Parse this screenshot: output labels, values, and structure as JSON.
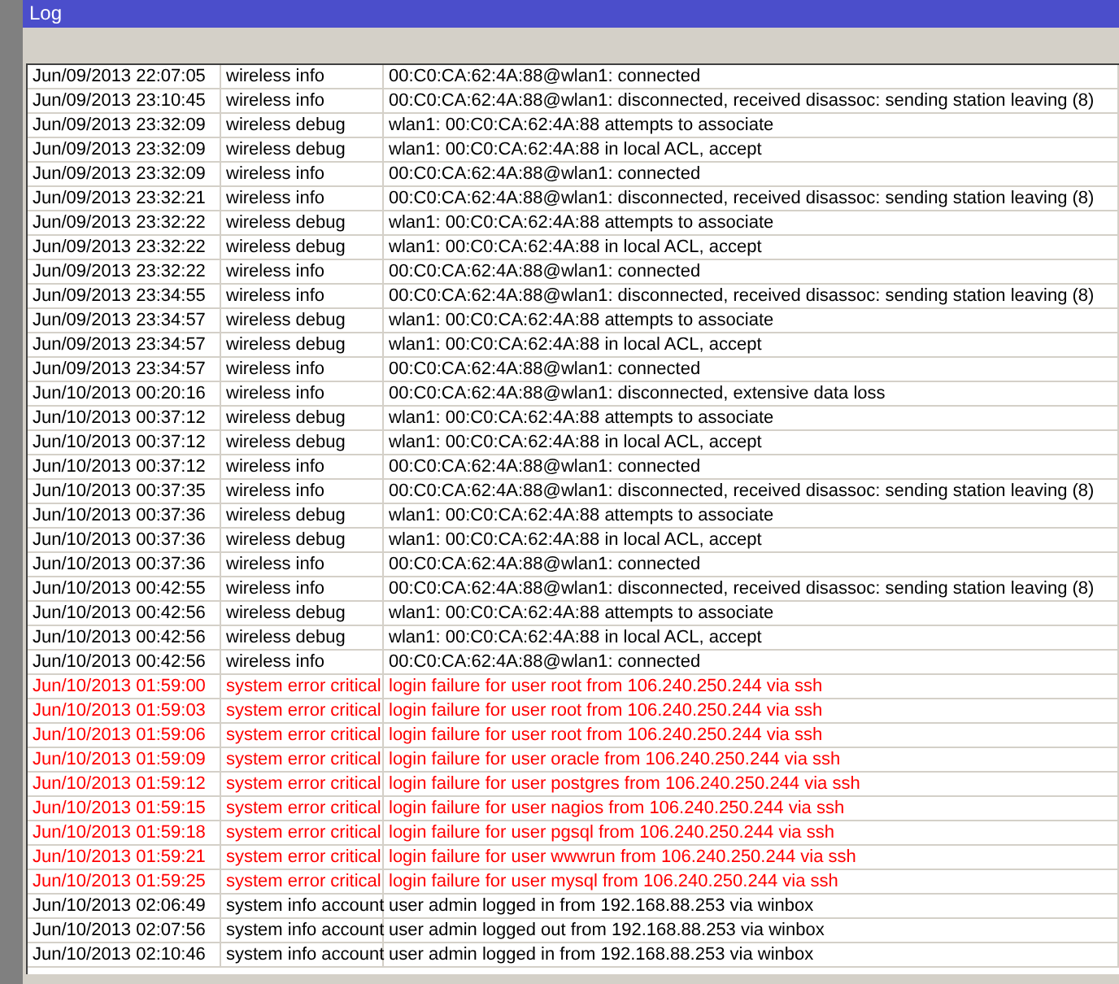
{
  "window": {
    "title": "Log"
  },
  "rows": [
    {
      "time": "Jun/09/2013 22:07:05",
      "topics": "wireless info",
      "message": "00:C0:CA:62:4A:88@wlan1: connected",
      "critical": false
    },
    {
      "time": "Jun/09/2013 23:10:45",
      "topics": "wireless info",
      "message": "00:C0:CA:62:4A:88@wlan1: disconnected, received disassoc: sending station leaving (8)",
      "critical": false
    },
    {
      "time": "Jun/09/2013 23:32:09",
      "topics": "wireless debug",
      "message": "wlan1: 00:C0:CA:62:4A:88 attempts to associate",
      "critical": false
    },
    {
      "time": "Jun/09/2013 23:32:09",
      "topics": "wireless debug",
      "message": "wlan1: 00:C0:CA:62:4A:88 in local ACL, accept",
      "critical": false
    },
    {
      "time": "Jun/09/2013 23:32:09",
      "topics": "wireless info",
      "message": "00:C0:CA:62:4A:88@wlan1: connected",
      "critical": false
    },
    {
      "time": "Jun/09/2013 23:32:21",
      "topics": "wireless info",
      "message": "00:C0:CA:62:4A:88@wlan1: disconnected, received disassoc: sending station leaving (8)",
      "critical": false
    },
    {
      "time": "Jun/09/2013 23:32:22",
      "topics": "wireless debug",
      "message": "wlan1: 00:C0:CA:62:4A:88 attempts to associate",
      "critical": false
    },
    {
      "time": "Jun/09/2013 23:32:22",
      "topics": "wireless debug",
      "message": "wlan1: 00:C0:CA:62:4A:88 in local ACL, accept",
      "critical": false
    },
    {
      "time": "Jun/09/2013 23:32:22",
      "topics": "wireless info",
      "message": "00:C0:CA:62:4A:88@wlan1: connected",
      "critical": false
    },
    {
      "time": "Jun/09/2013 23:34:55",
      "topics": "wireless info",
      "message": "00:C0:CA:62:4A:88@wlan1: disconnected, received disassoc: sending station leaving (8)",
      "critical": false
    },
    {
      "time": "Jun/09/2013 23:34:57",
      "topics": "wireless debug",
      "message": "wlan1: 00:C0:CA:62:4A:88 attempts to associate",
      "critical": false
    },
    {
      "time": "Jun/09/2013 23:34:57",
      "topics": "wireless debug",
      "message": "wlan1: 00:C0:CA:62:4A:88 in local ACL, accept",
      "critical": false
    },
    {
      "time": "Jun/09/2013 23:34:57",
      "topics": "wireless info",
      "message": "00:C0:CA:62:4A:88@wlan1: connected",
      "critical": false
    },
    {
      "time": "Jun/10/2013 00:20:16",
      "topics": "wireless info",
      "message": "00:C0:CA:62:4A:88@wlan1: disconnected, extensive data loss",
      "critical": false
    },
    {
      "time": "Jun/10/2013 00:37:12",
      "topics": "wireless debug",
      "message": "wlan1: 00:C0:CA:62:4A:88 attempts to associate",
      "critical": false
    },
    {
      "time": "Jun/10/2013 00:37:12",
      "topics": "wireless debug",
      "message": "wlan1: 00:C0:CA:62:4A:88 in local ACL, accept",
      "critical": false
    },
    {
      "time": "Jun/10/2013 00:37:12",
      "topics": "wireless info",
      "message": "00:C0:CA:62:4A:88@wlan1: connected",
      "critical": false
    },
    {
      "time": "Jun/10/2013 00:37:35",
      "topics": "wireless info",
      "message": "00:C0:CA:62:4A:88@wlan1: disconnected, received disassoc: sending station leaving (8)",
      "critical": false
    },
    {
      "time": "Jun/10/2013 00:37:36",
      "topics": "wireless debug",
      "message": "wlan1: 00:C0:CA:62:4A:88 attempts to associate",
      "critical": false
    },
    {
      "time": "Jun/10/2013 00:37:36",
      "topics": "wireless debug",
      "message": "wlan1: 00:C0:CA:62:4A:88 in local ACL, accept",
      "critical": false
    },
    {
      "time": "Jun/10/2013 00:37:36",
      "topics": "wireless info",
      "message": "00:C0:CA:62:4A:88@wlan1: connected",
      "critical": false
    },
    {
      "time": "Jun/10/2013 00:42:55",
      "topics": "wireless info",
      "message": "00:C0:CA:62:4A:88@wlan1: disconnected, received disassoc: sending station leaving (8)",
      "critical": false
    },
    {
      "time": "Jun/10/2013 00:42:56",
      "topics": "wireless debug",
      "message": "wlan1: 00:C0:CA:62:4A:88 attempts to associate",
      "critical": false
    },
    {
      "time": "Jun/10/2013 00:42:56",
      "topics": "wireless debug",
      "message": "wlan1: 00:C0:CA:62:4A:88 in local ACL, accept",
      "critical": false
    },
    {
      "time": "Jun/10/2013 00:42:56",
      "topics": "wireless info",
      "message": "00:C0:CA:62:4A:88@wlan1: connected",
      "critical": false
    },
    {
      "time": "Jun/10/2013 01:59:00",
      "topics": "system error critical",
      "message": "login failure for user root from 106.240.250.244 via ssh",
      "critical": true
    },
    {
      "time": "Jun/10/2013 01:59:03",
      "topics": "system error critical",
      "message": "login failure for user root from 106.240.250.244 via ssh",
      "critical": true
    },
    {
      "time": "Jun/10/2013 01:59:06",
      "topics": "system error critical",
      "message": "login failure for user root from 106.240.250.244 via ssh",
      "critical": true
    },
    {
      "time": "Jun/10/2013 01:59:09",
      "topics": "system error critical",
      "message": "login failure for user oracle from 106.240.250.244 via ssh",
      "critical": true
    },
    {
      "time": "Jun/10/2013 01:59:12",
      "topics": "system error critical",
      "message": "login failure for user postgres from 106.240.250.244 via ssh",
      "critical": true
    },
    {
      "time": "Jun/10/2013 01:59:15",
      "topics": "system error critical",
      "message": "login failure for user nagios from 106.240.250.244 via ssh",
      "critical": true
    },
    {
      "time": "Jun/10/2013 01:59:18",
      "topics": "system error critical",
      "message": "login failure for user pgsql from 106.240.250.244 via ssh",
      "critical": true
    },
    {
      "time": "Jun/10/2013 01:59:21",
      "topics": "system error critical",
      "message": "login failure for user wwwrun from 106.240.250.244 via ssh",
      "critical": true
    },
    {
      "time": "Jun/10/2013 01:59:25",
      "topics": "system error critical",
      "message": "login failure for user mysql from 106.240.250.244 via ssh",
      "critical": true
    },
    {
      "time": "Jun/10/2013 02:06:49",
      "topics": "system info account",
      "message": "user admin logged in from 192.168.88.253 via winbox",
      "critical": false
    },
    {
      "time": "Jun/10/2013 02:07:56",
      "topics": "system info account",
      "message": "user admin logged out from 192.168.88.253 via winbox",
      "critical": false
    },
    {
      "time": "Jun/10/2013 02:10:46",
      "topics": "system info account",
      "message": "user admin logged in from 192.168.88.253 via winbox",
      "critical": false
    }
  ]
}
